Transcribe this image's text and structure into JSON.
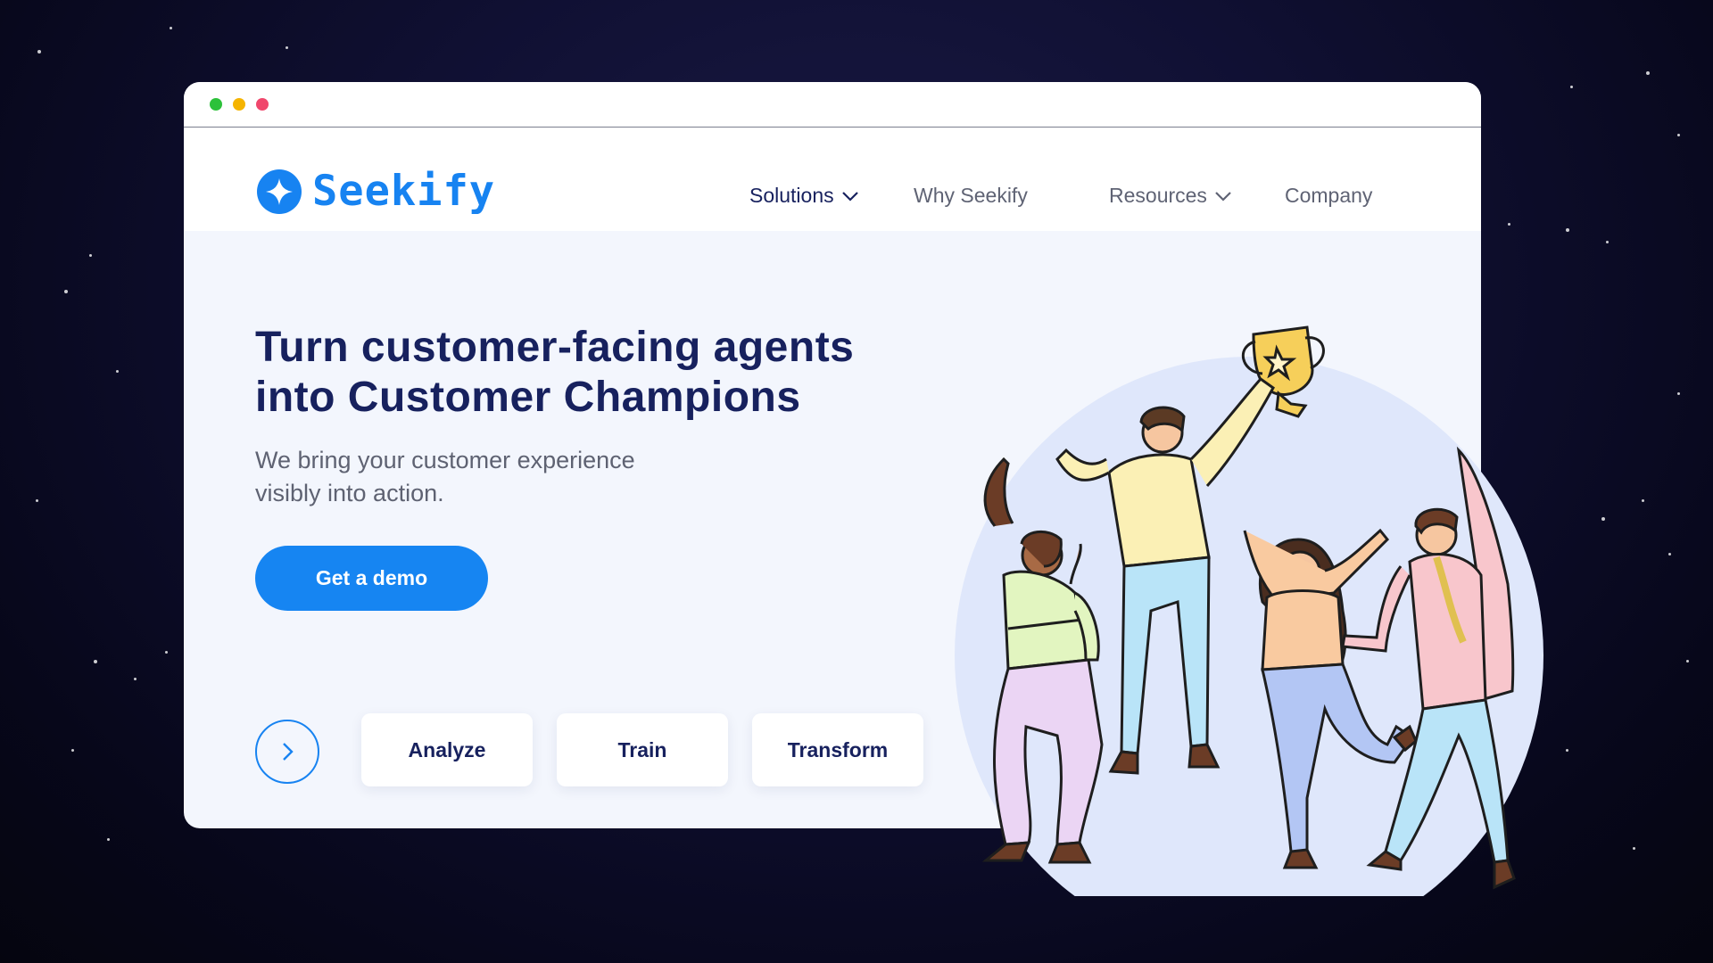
{
  "brand": {
    "name": "Seekify",
    "accent": "#1783f1",
    "logo_icon": "sparkle-star-icon"
  },
  "window_controls": [
    "green-dot",
    "yellow-dot",
    "red-dot"
  ],
  "nav": {
    "items": [
      {
        "label": "Solutions",
        "has_dropdown": true,
        "active": true
      },
      {
        "label": "Why Seekify",
        "has_dropdown": false,
        "active": false
      },
      {
        "label": "Resources",
        "has_dropdown": true,
        "active": false
      },
      {
        "label": "Company",
        "has_dropdown": false,
        "active": false
      }
    ]
  },
  "hero": {
    "title_line1": "Turn customer-facing agents",
    "title_line2": "into Customer Champions",
    "subtitle_line1": "We bring your customer experience",
    "subtitle_line2": "visibly into action.",
    "cta_label": "Get a demo"
  },
  "tabs": [
    {
      "label": "Analyze"
    },
    {
      "label": "Train"
    },
    {
      "label": "Transform"
    }
  ],
  "illustration": {
    "subject": "celebrating-team-with-trophy"
  },
  "colors": {
    "navy": "#17215e",
    "muted": "#5f6374",
    "background": "#f3f6fd",
    "blob": "#dfe7fb"
  }
}
